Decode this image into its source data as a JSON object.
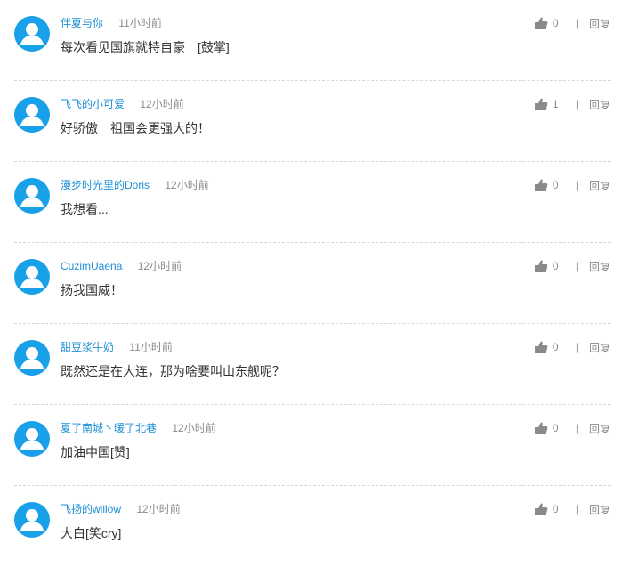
{
  "colors": {
    "avatar_bg": "#18a0e8",
    "username": "#1d8fd6",
    "muted": "#8a8a8a",
    "text": "#333333",
    "divider": "#d6d6d6"
  },
  "icons": {
    "avatar": "user-avatar-icon",
    "like": "thumbs-up-icon"
  },
  "comments": [
    {
      "username": "伴夏与你",
      "time": "11小时前",
      "content": "每次看见国旗就特自豪　[鼓掌]",
      "likes": "0",
      "reply_label": "回复"
    },
    {
      "username": "飞飞的小可爱",
      "time": "12小时前",
      "content": "好骄傲　祖国会更强大的！",
      "likes": "1",
      "reply_label": "回复"
    },
    {
      "username": "漫步时光里的Doris",
      "time": "12小时前",
      "content": "我想看...",
      "likes": "0",
      "reply_label": "回复"
    },
    {
      "username": "CuzimUaena",
      "time": "12小时前",
      "content": "扬我国威！",
      "likes": "0",
      "reply_label": "回复"
    },
    {
      "username": "甜豆浆牛奶",
      "time": "11小时前",
      "content": "既然还是在大连，那为啥要叫山东舰呢？",
      "likes": "0",
      "reply_label": "回复"
    },
    {
      "username": "夏了南城丶暖了北巷",
      "time": "12小时前",
      "content": "加油中国[赞]",
      "likes": "0",
      "reply_label": "回复"
    },
    {
      "username": "飞扬的willow",
      "time": "12小时前",
      "content": "大白[笑cry]",
      "likes": "0",
      "reply_label": "回复"
    }
  ]
}
